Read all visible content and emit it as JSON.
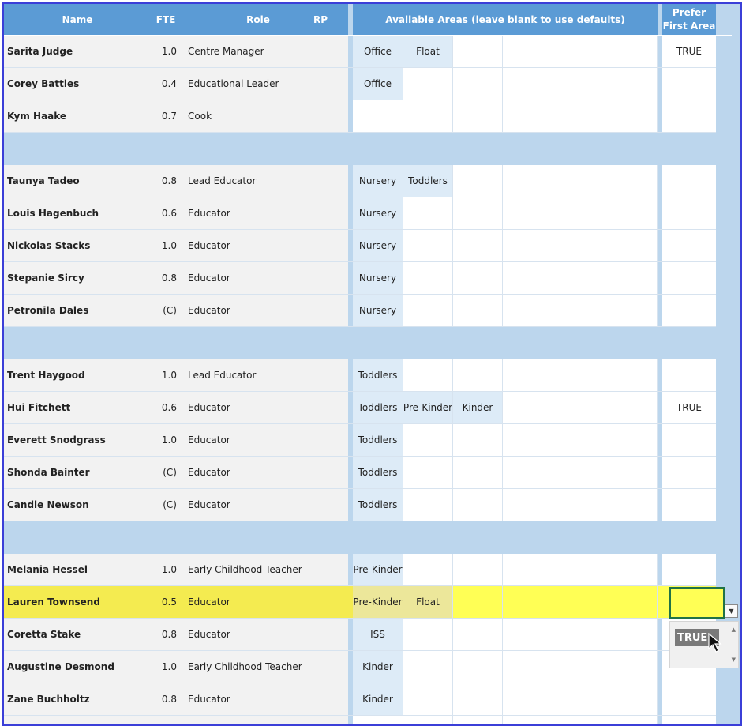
{
  "header": {
    "name": "Name",
    "fte": "FTE",
    "role": "Role",
    "rp": "RP",
    "areas": "Available Areas (leave blank to use defaults)",
    "prefer_line1": "Prefer",
    "prefer_line2": "First Area"
  },
  "rows": [
    {
      "name": "Sarita Judge",
      "fte": "1.0",
      "role": "Centre Manager",
      "areas": [
        "Office",
        "Float"
      ],
      "prefer": "TRUE"
    },
    {
      "name": "Corey Battles",
      "fte": "0.4",
      "role": "Educational Leader",
      "areas": [
        "Office"
      ],
      "prefer": ""
    },
    {
      "name": "Kym Haake",
      "fte": "0.7",
      "role": "Cook",
      "areas": [],
      "prefer": ""
    },
    {
      "separator": true
    },
    {
      "name": "Taunya Tadeo",
      "fte": "0.8",
      "role": "Lead Educator",
      "areas": [
        "Nursery",
        "Toddlers"
      ],
      "prefer": ""
    },
    {
      "name": "Louis Hagenbuch",
      "fte": "0.6",
      "role": "Educator",
      "areas": [
        "Nursery"
      ],
      "prefer": ""
    },
    {
      "name": "Nickolas Stacks",
      "fte": "1.0",
      "role": "Educator",
      "areas": [
        "Nursery"
      ],
      "prefer": ""
    },
    {
      "name": "Stepanie Sircy",
      "fte": "0.8",
      "role": "Educator",
      "areas": [
        "Nursery"
      ],
      "prefer": ""
    },
    {
      "name": "Petronila Dales",
      "fte": "(C)",
      "role": "Educator",
      "areas": [
        "Nursery"
      ],
      "prefer": ""
    },
    {
      "separator": true
    },
    {
      "name": "Trent Haygood",
      "fte": "1.0",
      "role": "Lead Educator",
      "areas": [
        "Toddlers"
      ],
      "prefer": ""
    },
    {
      "name": "Hui Fitchett",
      "fte": "0.6",
      "role": "Educator",
      "areas": [
        "Toddlers",
        "Pre-Kinder",
        "Kinder"
      ],
      "prefer": "TRUE"
    },
    {
      "name": "Everett Snodgrass",
      "fte": "1.0",
      "role": "Educator",
      "areas": [
        "Toddlers"
      ],
      "prefer": ""
    },
    {
      "name": "Shonda Bainter",
      "fte": "(C)",
      "role": "Educator",
      "areas": [
        "Toddlers"
      ],
      "prefer": ""
    },
    {
      "name": "Candie Newson",
      "fte": "(C)",
      "role": "Educator",
      "areas": [
        "Toddlers"
      ],
      "prefer": ""
    },
    {
      "separator": true
    },
    {
      "name": "Melania Hessel",
      "fte": "1.0",
      "role": "Early Childhood Teacher",
      "areas": [
        "Pre-Kinder"
      ],
      "prefer": ""
    },
    {
      "name": "Lauren Townsend",
      "fte": "0.5",
      "role": "Educator",
      "areas": [
        "Pre-Kinder",
        "Float"
      ],
      "prefer": "",
      "highlighted": true
    },
    {
      "name": "Coretta Stake",
      "fte": "0.8",
      "role": "Educator",
      "areas": [
        "ISS"
      ],
      "prefer": ""
    },
    {
      "name": "Augustine Desmond",
      "fte": "1.0",
      "role": "Early Childhood Teacher",
      "areas": [
        "Kinder"
      ],
      "prefer": ""
    },
    {
      "name": "Zane Buchholtz",
      "fte": "0.8",
      "role": "Educator",
      "areas": [
        "Kinder"
      ],
      "prefer": ""
    },
    {
      "name": "",
      "fte": "",
      "role": "",
      "areas": [],
      "prefer": ""
    }
  ],
  "dropdown": {
    "option": "TRUE"
  },
  "colors": {
    "header": "#5b9bd5",
    "separator": "#bcd6ed",
    "area_fill": "#ddebf7",
    "highlight": "#ffff55",
    "frame": "#3b3fd8",
    "selection": "#217346"
  }
}
